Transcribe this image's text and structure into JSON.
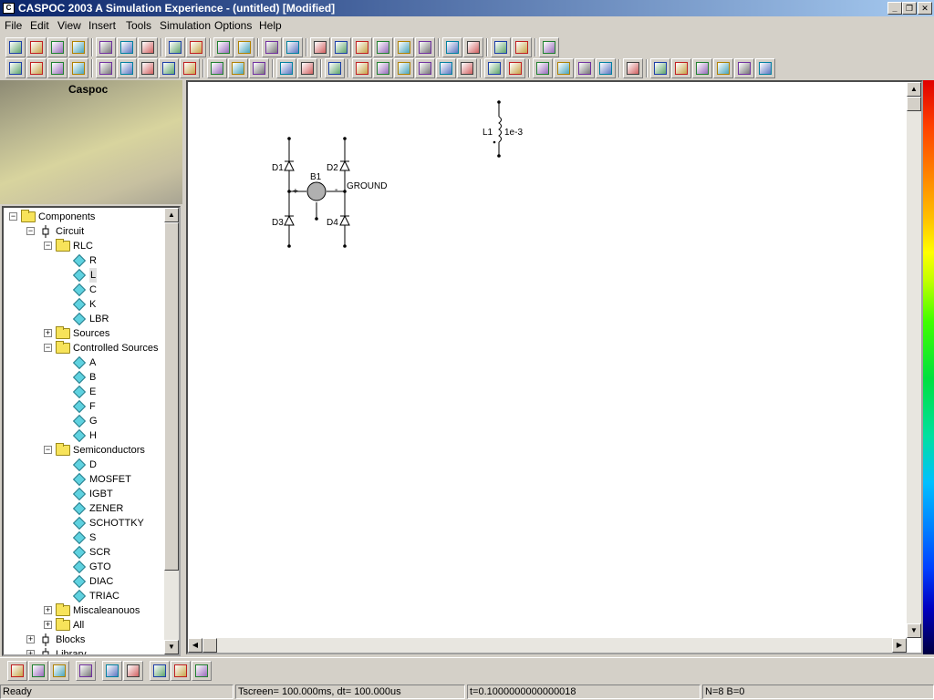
{
  "window": {
    "title": "CASPOC 2003 A Simulation Experience - (untitled) [Modified]",
    "min": "_",
    "restore": "❐",
    "close": "✕"
  },
  "menu": [
    "File",
    "Edit",
    "View",
    "Insert",
    "Tools",
    "Simulation",
    "Options",
    "Help"
  ],
  "toolbar_row1": [
    "new",
    "open",
    "save",
    "print",
    "cut",
    "copy",
    "paste",
    "undo",
    "redo",
    "run",
    "pause",
    "scope-a",
    "scope-b",
    "select-hand",
    "measure",
    "list-a",
    "list-b",
    "list-c",
    "insert-a",
    "insert-b",
    "doc-a",
    "doc-b",
    "swap",
    "help"
  ],
  "toolbar_row2": [
    "zoom-100",
    "zoom-fit",
    "zoom-width",
    "zoom-height",
    "node",
    "wire-v",
    "branch",
    "split",
    "probe",
    "net-a",
    "net-b",
    "net-c",
    "pen",
    "text-abc",
    "colors",
    "cross",
    "arrow-a",
    "arrow-b",
    "switch",
    "counter",
    "graph",
    "point",
    "grid",
    "clock",
    "paint",
    "bars",
    "move",
    "flame",
    "cut-r",
    "sort",
    "chip-a",
    "chip-b",
    "chip-c",
    "table"
  ],
  "left_panel": {
    "banner_title": "Caspoc",
    "tree": [
      {
        "label": "Components",
        "level": 0,
        "expander": "−",
        "icon": "folder"
      },
      {
        "label": "Circuit",
        "level": 1,
        "expander": "−",
        "icon": "component"
      },
      {
        "label": "RLC",
        "level": 2,
        "expander": "−",
        "icon": "folder"
      },
      {
        "label": "R",
        "level": 3,
        "icon": "diamond"
      },
      {
        "label": "L",
        "level": 3,
        "icon": "diamond",
        "selected": true
      },
      {
        "label": "C",
        "level": 3,
        "icon": "diamond"
      },
      {
        "label": "K",
        "level": 3,
        "icon": "diamond"
      },
      {
        "label": "LBR",
        "level": 3,
        "icon": "diamond"
      },
      {
        "label": "Sources",
        "level": 2,
        "expander": "+",
        "icon": "folder"
      },
      {
        "label": "Controlled Sources",
        "level": 2,
        "expander": "−",
        "icon": "folder"
      },
      {
        "label": "A",
        "level": 3,
        "icon": "diamond"
      },
      {
        "label": "B",
        "level": 3,
        "icon": "diamond"
      },
      {
        "label": "E",
        "level": 3,
        "icon": "diamond"
      },
      {
        "label": "F",
        "level": 3,
        "icon": "diamond"
      },
      {
        "label": "G",
        "level": 3,
        "icon": "diamond"
      },
      {
        "label": "H",
        "level": 3,
        "icon": "diamond"
      },
      {
        "label": "Semiconductors",
        "level": 2,
        "expander": "−",
        "icon": "folder"
      },
      {
        "label": "D",
        "level": 3,
        "icon": "diamond"
      },
      {
        "label": "MOSFET",
        "level": 3,
        "icon": "diamond"
      },
      {
        "label": "IGBT",
        "level": 3,
        "icon": "diamond"
      },
      {
        "label": "ZENER",
        "level": 3,
        "icon": "diamond"
      },
      {
        "label": "SCHOTTKY",
        "level": 3,
        "icon": "diamond"
      },
      {
        "label": "S",
        "level": 3,
        "icon": "diamond"
      },
      {
        "label": "SCR",
        "level": 3,
        "icon": "diamond"
      },
      {
        "label": "GTO",
        "level": 3,
        "icon": "diamond"
      },
      {
        "label": "DIAC",
        "level": 3,
        "icon": "diamond"
      },
      {
        "label": "TRIAC",
        "level": 3,
        "icon": "diamond"
      },
      {
        "label": "Miscaleanouos",
        "level": 2,
        "expander": "+",
        "icon": "folder"
      },
      {
        "label": "All",
        "level": 2,
        "expander": "+",
        "icon": "folder"
      },
      {
        "label": "Blocks",
        "level": 1,
        "expander": "+",
        "icon": "component"
      },
      {
        "label": "Library",
        "level": 1,
        "expander": "+",
        "icon": "component"
      }
    ]
  },
  "schematic": {
    "labels": {
      "d1": "D1",
      "d2": "D2",
      "d3": "D3",
      "d4": "D4",
      "b1": "B1",
      "ground": "GROUND",
      "plus": "+",
      "minus": "-",
      "l1": "L1",
      "l1_value": "1e-3"
    }
  },
  "bottom_toolbar": [
    "components",
    "blocks",
    "chip",
    "refresh",
    "tile-a",
    "tile-b",
    "img-a",
    "img-b",
    "img-c"
  ],
  "status": {
    "ready": "Ready",
    "tscreen": "Tscreen= 100.000ms, dt= 100.000us",
    "time": "t=0.1000000000000018",
    "counts": "N=8 B=0"
  }
}
